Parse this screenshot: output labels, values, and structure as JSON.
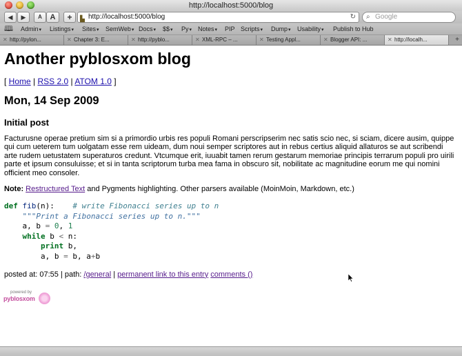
{
  "window": {
    "title": "http://localhost:5000/blog"
  },
  "toolbar": {
    "back_icon": "back-arrow-icon",
    "forward_icon": "forward-arrow-icon",
    "text_smaller": "A",
    "text_larger": "A",
    "add_label": "+",
    "url": "http://localhost:5000/blog",
    "search_placeholder": "Google"
  },
  "bookmarks": [
    {
      "label": "Admin",
      "menu": true
    },
    {
      "label": "Listings",
      "menu": true
    },
    {
      "label": "Sites",
      "menu": true
    },
    {
      "label": "SemWeb",
      "menu": true
    },
    {
      "label": "Docs",
      "menu": true
    },
    {
      "label": "$$",
      "menu": true
    },
    {
      "label": "Py",
      "menu": true
    },
    {
      "label": "Notes",
      "menu": true
    },
    {
      "label": "PIP",
      "menu": false
    },
    {
      "label": "Scripts",
      "menu": true
    },
    {
      "label": "Dump",
      "menu": true
    },
    {
      "label": "Usability",
      "menu": true
    },
    {
      "label": "Publish to Hub",
      "menu": false
    }
  ],
  "tabs": [
    {
      "label": "http://pylon..."
    },
    {
      "label": "Chapter 3: E..."
    },
    {
      "label": "http://pyblo..."
    },
    {
      "label": "XML-RPC – ..."
    },
    {
      "label": "Testing Appl..."
    },
    {
      "label": "Blogger API: ..."
    },
    {
      "label": "http://localh..."
    }
  ],
  "tab_add": "+",
  "page": {
    "blog_title": "Another pyblosxom blog",
    "nav": {
      "open": "[ ",
      "home": "Home",
      "sep": " | ",
      "rss": "RSS 2.0",
      "atom": "ATOM 1.0",
      "close": " ]"
    },
    "date": "Mon, 14 Sep 2009",
    "post": {
      "title": "Initial post",
      "body": "Facturusne operae pretium sim si a primordio urbis res populi Romani perscripserim nec satis scio nec, si sciam, dicere ausim, quippe qui cum ueterem tum uolgatam esse rem uideam, dum noui semper scriptores aut in rebus certius aliquid allaturos se aut scribendi arte rudem uetustatem superaturos credunt. Vtcumque erit, iuuabit tamen rerum gestarum memoriae principis terrarum populi pro uirili parte et ipsum consuluisse; et si in tanta scriptorum turba mea fama in obscuro sit, nobilitate ac magnitudine eorum me qui nomini officient meo consoler.",
      "note_label": "Note:",
      "note_link": "Restructured Text",
      "note_rest": " and Pygments highlighting. Other parsers available (MoinMoin, Markdown, etc.)",
      "code": {
        "l1_def": "def",
        "l1_fn": "fib",
        "l1_args": "(n):",
        "l1_comment": "# write Fibonacci series up to n",
        "l2_doc": "\"\"\"Print a Fibonacci series up to n.\"\"\"",
        "l3_a": "a, b ",
        "l3_eq": "=",
        "l3_zero": "0",
        "l3_comma": ", ",
        "l3_one": "1",
        "l4_while": "while",
        "l4_cond": " b ",
        "l4_lt": "<",
        "l4_n": " n:",
        "l5_print": "print",
        "l5_rest": " b,",
        "l6_a": "a, b ",
        "l6_eq": "=",
        "l6_b": " b, a",
        "l6_plus": "+",
        "l6_end": "b"
      },
      "footer": {
        "posted_prefix": "posted at: 07:55 | path: ",
        "path_link": "/general",
        "sep": " | ",
        "permalink": "permanent link to this entry",
        "space": " ",
        "comments": "comments ()"
      }
    },
    "powered_by": {
      "small": "powered by",
      "name": "pyblosxom"
    }
  }
}
